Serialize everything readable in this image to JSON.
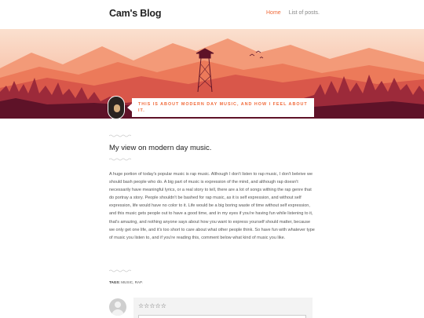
{
  "site": {
    "title": "Cam's Blog"
  },
  "nav": {
    "items": [
      {
        "label": "Home",
        "active": true
      },
      {
        "label": "List of posts."
      }
    ]
  },
  "hero": {
    "tagline": "This is about modern day music, and how I feel about it."
  },
  "post": {
    "title": "My view on modern day music.",
    "body": "A huge portion of today's popular music is rap music. Although I don't listen to rap music, I don't beleive we should bash people who do. A big part of music is expression of the mind, and although rap doesn't necessarily have meaningful lyrics, or a real story to tell, there are a lot of songs withing the rap genre that do portray a story. People shouldn't be bashed for rap music, as it is self expression, and without self expression, life would have no color to it. Life would be a big boring waste of time without self expression, and this music gets people out to have a good time, and in my eyes if you're having fun while listening to it, that's amazing, and nothing anyone says about how you want to express yourself should matter, because we only get one life, and it's too short to care about what other people think. So have fun with whatever type of music you listen to, and if you're reading this, comment below what kind of music you like.",
    "tags_label": "TAGS:",
    "tags": "MUSIC, RAP."
  },
  "comments": {
    "rating_stars": "☆☆☆☆☆"
  },
  "colors": {
    "accent": "#f06a3a",
    "hero_dark": "#7a1a2e",
    "hero_light": "#f6c8b0"
  },
  "icons": [
    "fire-tower-icon",
    "birds-icon",
    "avatar-icon",
    "star-icon"
  ]
}
